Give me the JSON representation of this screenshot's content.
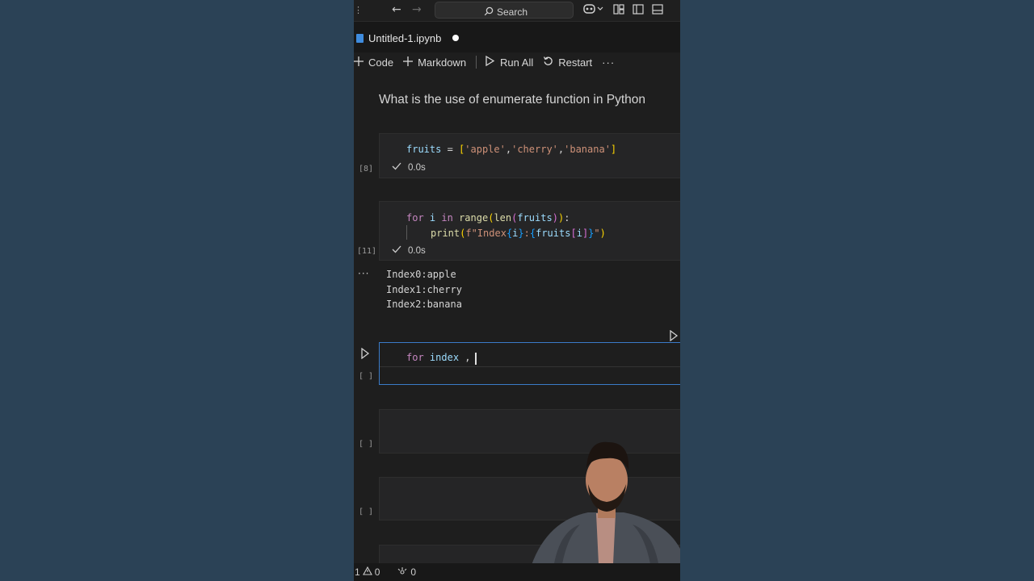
{
  "titlebar": {
    "search_placeholder": "Search"
  },
  "tab": {
    "filename": "Untitled-1.ipynb"
  },
  "toolbar": {
    "code_label": "Code",
    "markdown_label": "Markdown",
    "run_all_label": "Run All",
    "restart_label": "Restart"
  },
  "notebook": {
    "heading": "What is the use of enumerate function in Python",
    "cells": [
      {
        "count": "[8]",
        "line1": {
          "t1": "fruits",
          "t2": " = ",
          "t3": "[",
          "t4": "'apple'",
          "t5": ",",
          "t6": "'cherry'",
          "t7": ",",
          "t8": "'banana'",
          "t9": "]"
        },
        "status_time": "0.0s"
      },
      {
        "count": "[11]",
        "line1": {
          "t1": "for",
          "t2": "i",
          "t3": "in",
          "t4": "range",
          "t5": "(",
          "t6": "len",
          "t7": "(",
          "t8": "fruits",
          "t9": ")",
          "t10": ")",
          "t11": ":"
        },
        "line2": {
          "t1": "print",
          "t2": "(",
          "t3": "f\"Index",
          "t4": "{",
          "t5": "i",
          "t6": "}",
          "t7": ":",
          "t8": "{",
          "t9": "fruits",
          "t10": "[",
          "t11": "i",
          "t12": "]",
          "t13": "}",
          "t14": "\"",
          "t15": ")"
        },
        "status_time": "0.0s",
        "output": [
          "Index0:apple",
          "Index1:cherry",
          "Index2:banana"
        ]
      },
      {
        "count": "[ ]",
        "line1": {
          "t1": "for",
          "t2": "index",
          "t3": ","
        }
      },
      {
        "count": "[ ]"
      },
      {
        "count": "[ ]"
      }
    ]
  },
  "statusbar": {
    "errors": "1",
    "warnings": "0",
    "ports": "0"
  },
  "colors": {
    "background": "#2b4256",
    "editor": "#1e1e1e",
    "accent": "#3a7bc8",
    "keyword": "#c586c0",
    "variable": "#9cdcfe",
    "string": "#ce9178",
    "function": "#dcdcaa"
  }
}
